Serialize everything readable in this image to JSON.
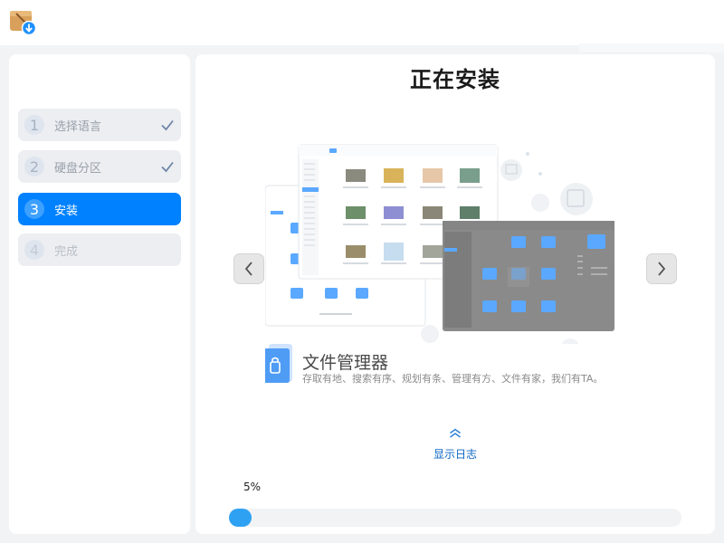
{
  "app": {
    "icon": "package-installer-icon"
  },
  "steps": [
    {
      "num": "1",
      "label": "选择语言",
      "status": "done"
    },
    {
      "num": "2",
      "label": "硬盘分区",
      "status": "done"
    },
    {
      "num": "3",
      "label": "安装",
      "status": "active"
    },
    {
      "num": "4",
      "label": "完成",
      "status": "pending"
    }
  ],
  "main": {
    "title": "正在安装",
    "slide": {
      "title": "文件管理器",
      "description": "存取有地、搜索有序、规划有条、管理有方、文件有家，我们有TA。"
    },
    "log": {
      "label": "显示日志",
      "icon": "chevron-double-up-icon"
    },
    "progress": {
      "text": "5%",
      "value": 0.05
    }
  },
  "colors": {
    "accent": "#0081ff",
    "progress": "#2ea1f3",
    "log_link": "#0b66c4"
  }
}
